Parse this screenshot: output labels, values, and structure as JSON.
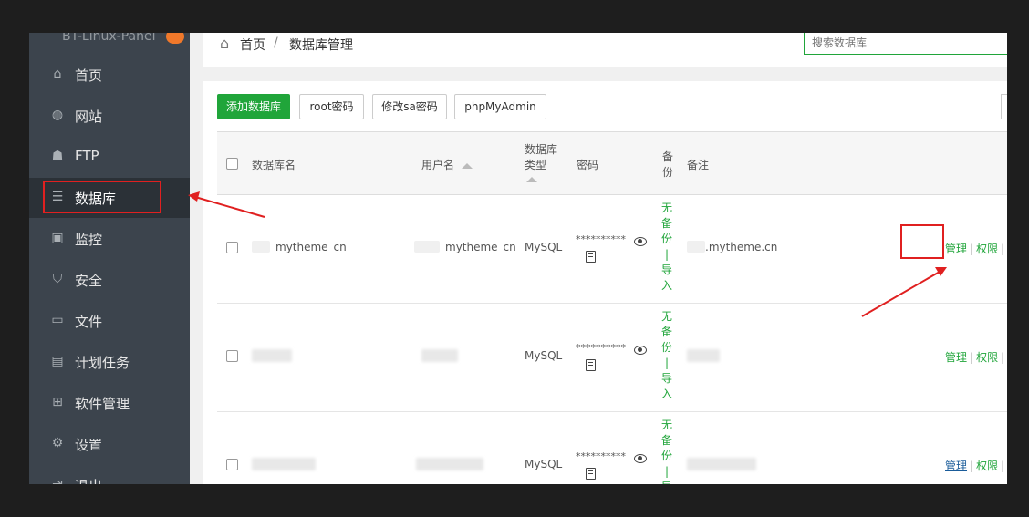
{
  "sidebar": {
    "logo_text": "BT-Linux-Panel",
    "items": [
      {
        "label": "首页",
        "icon": "home-icon"
      },
      {
        "label": "网站",
        "icon": "globe-icon"
      },
      {
        "label": "FTP",
        "icon": "ftp-icon"
      },
      {
        "label": "数据库",
        "icon": "database-icon",
        "active": true
      },
      {
        "label": "监控",
        "icon": "monitor-icon"
      },
      {
        "label": "安全",
        "icon": "shield-icon"
      },
      {
        "label": "文件",
        "icon": "folder-icon"
      },
      {
        "label": "计划任务",
        "icon": "calendar-icon"
      },
      {
        "label": "软件管理",
        "icon": "grid-icon"
      },
      {
        "label": "设置",
        "icon": "gear-icon"
      },
      {
        "label": "退出",
        "icon": "logout-icon"
      }
    ]
  },
  "breadcrumb": {
    "home": "首页",
    "separator": "/",
    "current": "数据库管理"
  },
  "search": {
    "placeholder": "搜索数据库"
  },
  "toolbar": {
    "add_label": "添加数据库",
    "root_label": "root密码",
    "sa_label": "修改sa密码",
    "phpmyadmin_label": "phpMyAdmin"
  },
  "table": {
    "headers": {
      "name": "数据库名",
      "user": "用户名",
      "type_line1": "数据库",
      "type_line2": "类型",
      "password": "密码",
      "backup_line1": "备",
      "backup_line2": "份",
      "note": "备注"
    },
    "rows": [
      {
        "name": "_mytheme_cn",
        "user": "_mytheme_cn",
        "type": "MySQL",
        "password": "**********",
        "backup": [
          "无",
          "备",
          "份",
          "|",
          "导",
          "入"
        ],
        "note": ".mytheme.cn",
        "ops": {
          "manage": "管理",
          "perm": "权限",
          "sep": "|"
        }
      },
      {
        "name": "",
        "user": "",
        "type": "MySQL",
        "password": "**********",
        "backup": [
          "无",
          "备",
          "份",
          "|",
          "导",
          "入"
        ],
        "note": "",
        "ops": {
          "manage": "管理",
          "perm": "权限",
          "sep": "|"
        }
      },
      {
        "name": "",
        "user": "",
        "type": "MySQL",
        "password": "**********",
        "backup": [
          "无",
          "备",
          "份",
          "|",
          "导"
        ],
        "note": "",
        "ops": {
          "manage": "管理",
          "perm": "权限",
          "sep": "|"
        }
      }
    ]
  },
  "colors": {
    "accent": "#20a53a",
    "annotation": "#e02020",
    "sidebar_bg": "#3c444d"
  }
}
